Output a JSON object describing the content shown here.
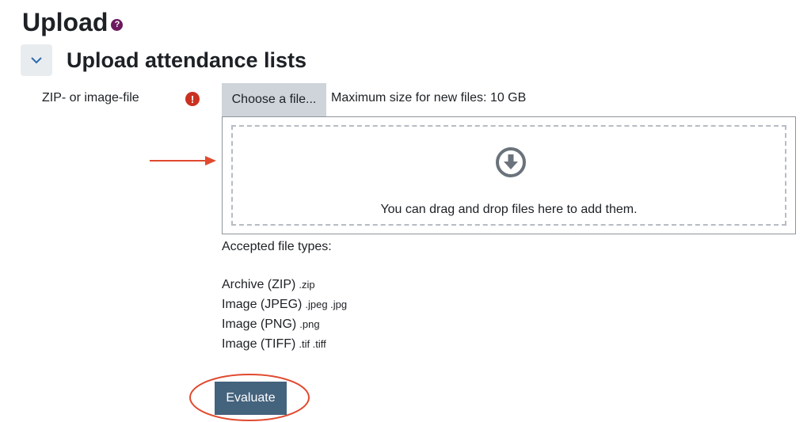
{
  "page": {
    "title": "Upload"
  },
  "section": {
    "title": "Upload attendance lists"
  },
  "field": {
    "label": "ZIP- or image-file",
    "choose_button": "Choose a file...",
    "max_size": "Maximum size for new files: 10 GB"
  },
  "dropzone": {
    "text": "You can drag and drop files here to add them."
  },
  "accepted": {
    "title": "Accepted file types:",
    "types": [
      {
        "name": "Archive (ZIP)",
        "ext": ".zip"
      },
      {
        "name": "Image (JPEG)",
        "ext": ".jpeg .jpg"
      },
      {
        "name": "Image (PNG)",
        "ext": ".png"
      },
      {
        "name": "Image (TIFF)",
        "ext": ".tif .tiff"
      }
    ]
  },
  "actions": {
    "evaluate": "Evaluate"
  },
  "colors": {
    "help_icon": "#6b1a5e",
    "required_icon": "#ca3120",
    "primary_button": "#44637d",
    "annotation_red": "#e04a2f"
  },
  "icons": {
    "help": "question-circle-icon",
    "collapse": "chevron-down-icon",
    "required": "exclamation-circle-icon",
    "dropzone": "arrow-circle-down-icon"
  }
}
